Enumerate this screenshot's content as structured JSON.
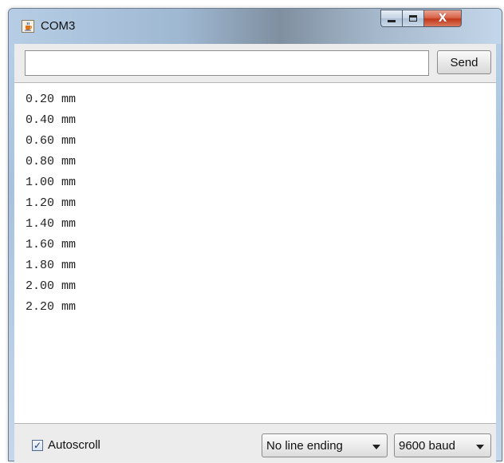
{
  "window": {
    "title": "COM3",
    "icon": "java-cup-icon",
    "controls": {
      "minimize": "minimize-icon",
      "maximize": "maximize-icon",
      "close": "close-icon",
      "close_glyph": "X"
    }
  },
  "send_bar": {
    "input_value": "",
    "input_placeholder": "",
    "send_label": "Send"
  },
  "output": {
    "lines": [
      "0.20 mm",
      "0.40 mm",
      "0.60 mm",
      "0.80 mm",
      "1.00 mm",
      "1.20 mm",
      "1.40 mm",
      "1.60 mm",
      "1.80 mm",
      "2.00 mm",
      "2.20 mm"
    ]
  },
  "footer": {
    "autoscroll_label": "Autoscroll",
    "autoscroll_checked": true,
    "line_ending_selected": "No line ending",
    "baud_selected": "9600 baud"
  },
  "colors": {
    "close_button": "#c2381c",
    "titlebar": "#b6cde5",
    "client_bg": "#ececec"
  }
}
